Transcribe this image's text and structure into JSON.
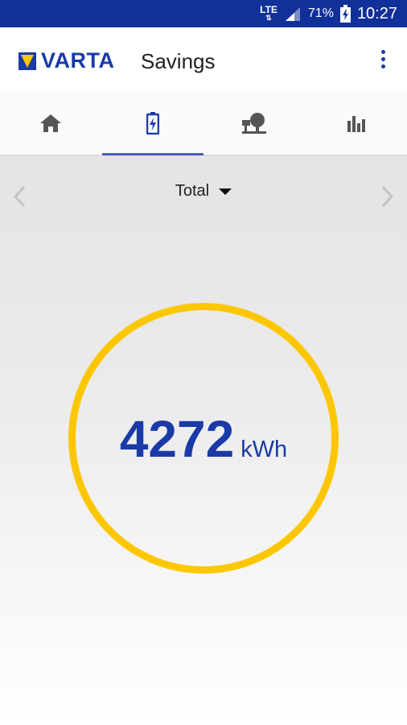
{
  "status_bar": {
    "network": "LTE",
    "battery_percent": "71%",
    "time": "10:27"
  },
  "app_bar": {
    "brand": "VARTA",
    "title": "Savings"
  },
  "tabs": [
    {
      "icon": "home-icon",
      "active": false
    },
    {
      "icon": "battery-charging-icon",
      "active": true
    },
    {
      "icon": "grid-consumer-icon",
      "active": false
    },
    {
      "icon": "bar-chart-icon",
      "active": false
    }
  ],
  "period": {
    "selected": "Total"
  },
  "savings": {
    "value": "4272",
    "unit": "kWh"
  },
  "colors": {
    "brand_blue": "#1a3aa8",
    "status_bar": "#12309a",
    "ring_yellow": "#fcc700",
    "tab_indicator": "#4a5db8"
  }
}
